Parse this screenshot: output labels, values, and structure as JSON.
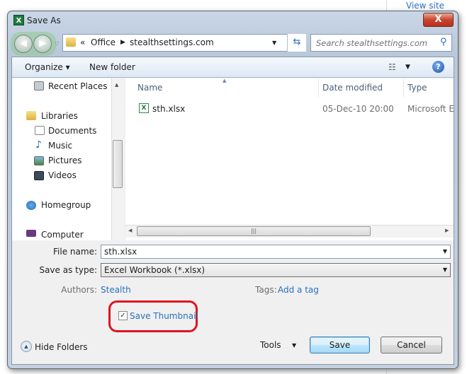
{
  "background": {
    "view_site": "View site"
  },
  "dialog": {
    "title": "Save As",
    "close": "X"
  },
  "nav": {
    "back": "◀",
    "forward": "▶",
    "breadcrumb_overflow": "«",
    "breadcrumb": [
      "Office",
      "stealthsettings.com"
    ],
    "search_placeholder": "Search stealthsettings.com"
  },
  "toolbar": {
    "organize": "Organize ▾",
    "new_folder": "New folder",
    "help": "?"
  },
  "sidebar": {
    "items": [
      {
        "label": "Recent Places"
      },
      {
        "label": "Libraries"
      },
      {
        "label": "Documents"
      },
      {
        "label": "Music"
      },
      {
        "label": "Pictures"
      },
      {
        "label": "Videos"
      },
      {
        "label": "Homegroup"
      },
      {
        "label": "Computer"
      }
    ]
  },
  "files": {
    "columns": [
      "Name",
      "Date modified",
      "Type"
    ],
    "rows": [
      {
        "name": "sth.xlsx",
        "date": "05-Dec-10 20:00",
        "type": "Microsoft Ex"
      }
    ]
  },
  "form": {
    "file_name_label": "File name:",
    "file_name": "sth.xlsx",
    "type_label": "Save as type:",
    "type": "Excel Workbook (*.xlsx)",
    "authors_label": "Authors:",
    "authors": "Stealth",
    "tags_label": "Tags:",
    "tags": "Add a tag",
    "thumbnail_label": "Save Thumbnail",
    "thumbnail_checked": true
  },
  "footer": {
    "hide_folders": "Hide Folders",
    "tools": "Tools",
    "save": "Save",
    "cancel": "Cancel"
  }
}
